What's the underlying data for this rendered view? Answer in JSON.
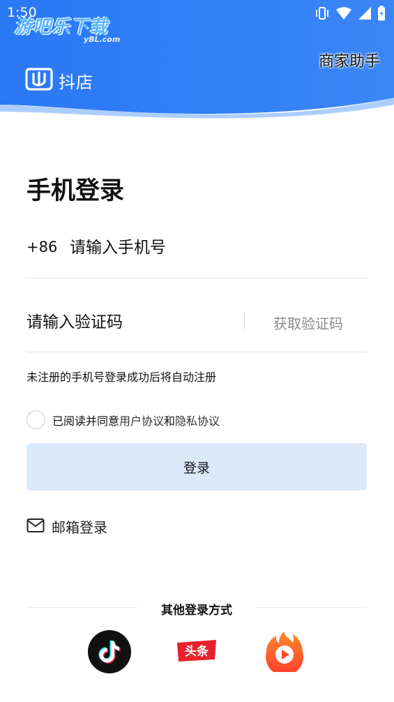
{
  "status_bar": {
    "time": "1:50"
  },
  "watermark": {
    "text": "游吧乐下载",
    "sub": "yBL.com"
  },
  "header": {
    "helper_link": "商家助手",
    "brand_name": "抖店"
  },
  "login": {
    "title": "手机登录",
    "country_code": "+86",
    "phone_placeholder": "请输入手机号",
    "code_placeholder": "请输入验证码",
    "get_code_label": "获取验证码",
    "register_note": "未注册的手机号登录成功后将自动注册",
    "agreement_prefix": "已阅读并同意",
    "user_agreement": "用户协议",
    "agreement_and": "和",
    "privacy_policy": "隐私协议",
    "login_button": "登录",
    "email_login": "邮箱登录",
    "other_methods": "其他登录方式"
  },
  "socials": [
    {
      "icon": "douyin-icon"
    },
    {
      "icon": "toutiao-icon",
      "text": "头条"
    },
    {
      "icon": "huoshan-icon"
    }
  ],
  "colors": {
    "header_blue": "#2f7df6",
    "login_button_bg": "#dce9fb",
    "toutiao_red": "#e8222c",
    "huoshan_orange": "#ff5a1f"
  }
}
